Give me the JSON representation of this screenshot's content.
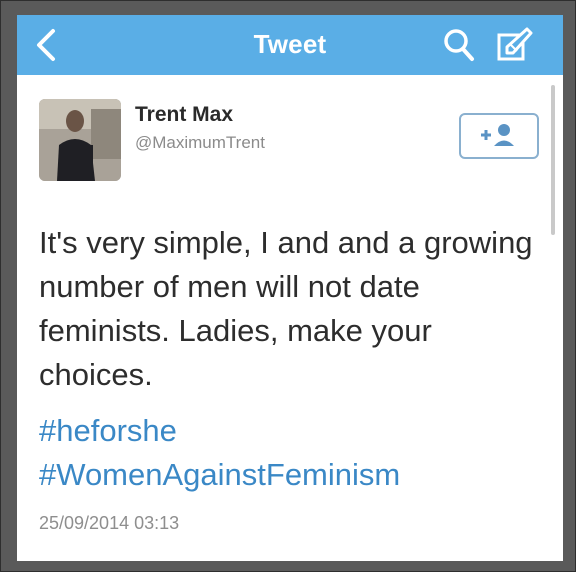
{
  "navbar": {
    "title": "Tweet",
    "back_icon": "chevron-left-icon",
    "search_icon": "search-icon",
    "compose_icon": "compose-icon"
  },
  "tweet": {
    "display_name": "Trent Max",
    "handle": "@MaximumTrent",
    "text": "It's very simple, I and and a growing number of men will not date feminists. Ladies, make your choices.",
    "hashtags": [
      "#heforshe",
      "#WomenAgainstFeminism"
    ],
    "timestamp": "25/09/2014 03:13",
    "follow_icon": "add-user-icon"
  },
  "colors": {
    "navbar": "#5aaee6",
    "hashtag": "#3a88c6",
    "follow_border": "#8ab0cf"
  }
}
